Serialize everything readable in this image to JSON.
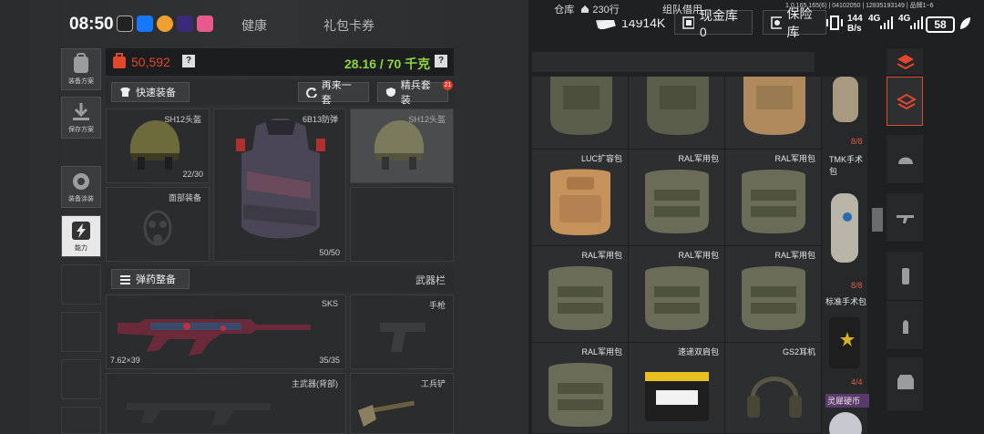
{
  "status_bar": {
    "time": "08:50",
    "build_info": "1.0.165.165(6) | 04102050 | 12835193149 | 品牌1~6",
    "network_speed": "144",
    "network_unit": "B/s",
    "signal1": "4G",
    "signal2": "4G",
    "battery": "58"
  },
  "top_tabs": {
    "health": "健康",
    "gift_card": "礼包卡券"
  },
  "currencies": {
    "coins": "14914K",
    "cash_stash": "现金库 0",
    "safe_box": "保险库"
  },
  "left_toolbar": [
    {
      "label": "装备方案",
      "icon": "backpack-icon"
    },
    {
      "label": "保存方案",
      "icon": "download-icon"
    },
    {
      "label": "装备涂装",
      "icon": "spray-icon"
    },
    {
      "label": "能力",
      "icon": "lightning-icon"
    }
  ],
  "loadout": {
    "money": "50,592",
    "capacity": "28.16 / 70 千克",
    "quick_equip": "快速装备",
    "repeat": "再来一套",
    "elite_set": "精兵套装",
    "elite_badge": "21",
    "helmet_label": "SH12头盔",
    "helmet_count": "22/30",
    "armor_label": "6B13防弹",
    "armor_count": "50/50",
    "helmet2_label": "SH12头盔",
    "face_label": "面部装备",
    "ammo_btn": "弹药整备",
    "weapon_bar": "武器栏",
    "primary_label": "SKS",
    "primary_caliber": "7.62×39",
    "primary_ammo": "35/35",
    "pistol_label": "手枪",
    "back_weapon_label": "主武器(背部)",
    "shovel_label": "工兵铲"
  },
  "stash": {
    "tab_stash": "仓库",
    "tab_rows": "230行",
    "tab_team": "组队借用",
    "items": [
      {
        "label": ""
      },
      {
        "label": ""
      },
      {
        "label": ""
      },
      {
        "label": "LUC扩容包"
      },
      {
        "label": "RAL军用包"
      },
      {
        "label": "RAL军用包"
      },
      {
        "label": "RAL军用包"
      },
      {
        "label": "RAL军用包"
      },
      {
        "label": "RAL军用包"
      },
      {
        "label": "RAL军用包"
      },
      {
        "label": "速递双肩包"
      },
      {
        "label": "GS2耳机"
      }
    ],
    "side": {
      "count1": "8/8",
      "tmk_label": "TMK手术包",
      "count2": "8/8",
      "kit_label": "标准手术包",
      "count3": "4/4",
      "coin_label": "灵犀硬币"
    }
  },
  "colors": {
    "accent_red": "#e2472e",
    "capacity_green": "#8dd640"
  }
}
